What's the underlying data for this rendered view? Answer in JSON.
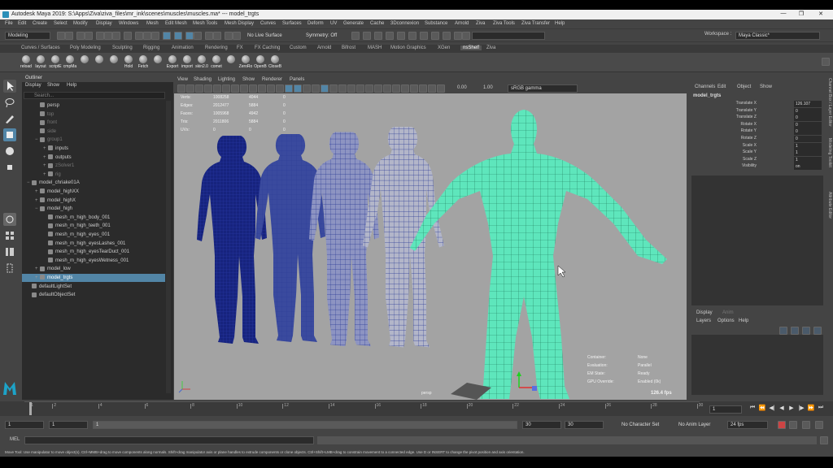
{
  "window": {
    "title": "Autodesk Maya 2019: S:\\Apps\\Ziva\\ziva_files\\mr_ink\\scenes\\muscles\\muscles.ma*  ---  model_trgts"
  },
  "menu": [
    "File",
    "Edit",
    "Create",
    "Select",
    "Modify",
    "Display",
    "Windows",
    "Mesh",
    "Edit Mesh",
    "Mesh Tools",
    "Mesh Display",
    "Curves",
    "Surfaces",
    "Deform",
    "UV",
    "Generate",
    "Cache",
    "3Dconnexion",
    "Substance",
    "Arnold",
    "Ziva",
    "Ziva Tools",
    "Ziva Transfer",
    "Help"
  ],
  "workspace": {
    "label": "Workspace :",
    "value": "Maya Classic*"
  },
  "status": {
    "mode": "Modeling",
    "live_surface": "No Live Surface",
    "symmetry": "Symmetry: Off"
  },
  "shelf_tabs": [
    "Curves / Surfaces",
    "Poly Modeling",
    "Sculpting",
    "Rigging",
    "Animation",
    "Rendering",
    "FX",
    "FX Caching",
    "Custom",
    "Arnold",
    "Bifrost",
    "MASH",
    "Motion Graphics",
    "XGen",
    "nsShelf",
    "Ziva"
  ],
  "shelf_active": "nsShelf",
  "shelf_buttons": [
    "reload",
    "layout",
    "scriptE",
    "cmpMa",
    "",
    "",
    "",
    "Hold",
    "Fetch",
    "",
    "Export",
    "import",
    "skin2.0",
    "comet",
    "",
    "ZeroRo",
    "OpenB",
    "CloseB"
  ],
  "outliner": {
    "title": "Outliner",
    "menu": [
      "Display",
      "Show",
      "Help"
    ],
    "search_placeholder": "Search...",
    "rows": [
      {
        "label": "persp",
        "indent": 1,
        "exp": "",
        "dim": false,
        "sel": false
      },
      {
        "label": "top",
        "indent": 1,
        "exp": "",
        "dim": true,
        "sel": false
      },
      {
        "label": "front",
        "indent": 1,
        "exp": "",
        "dim": true,
        "sel": false
      },
      {
        "label": "side",
        "indent": 1,
        "exp": "",
        "dim": true,
        "sel": false
      },
      {
        "label": "group1",
        "indent": 1,
        "exp": "−",
        "dim": true,
        "sel": false
      },
      {
        "label": "inputs",
        "indent": 2,
        "exp": "+",
        "dim": false,
        "sel": false
      },
      {
        "label": "outputs",
        "indent": 2,
        "exp": "+",
        "dim": false,
        "sel": false
      },
      {
        "label": "zSolver1",
        "indent": 2,
        "exp": "+",
        "dim": true,
        "sel": false
      },
      {
        "label": "rig",
        "indent": 2,
        "exp": "+",
        "dim": true,
        "sel": false
      },
      {
        "label": "model_chriake01A",
        "indent": 0,
        "exp": "−",
        "dim": false,
        "sel": false
      },
      {
        "label": "model_highXX",
        "indent": 1,
        "exp": "+",
        "dim": false,
        "sel": false
      },
      {
        "label": "model_highX",
        "indent": 1,
        "exp": "+",
        "dim": false,
        "sel": false
      },
      {
        "label": "model_high",
        "indent": 1,
        "exp": "−",
        "dim": false,
        "sel": false
      },
      {
        "label": "mesh_m_high_body_001",
        "indent": 2,
        "exp": "",
        "dim": false,
        "sel": false
      },
      {
        "label": "mesh_m_high_teeth_001",
        "indent": 2,
        "exp": "",
        "dim": false,
        "sel": false
      },
      {
        "label": "mesh_m_high_eyes_001",
        "indent": 2,
        "exp": "",
        "dim": false,
        "sel": false
      },
      {
        "label": "mesh_m_high_eyesLashes_001",
        "indent": 2,
        "exp": "",
        "dim": false,
        "sel": false
      },
      {
        "label": "mesh_m_high_eyesTearDuct_001",
        "indent": 2,
        "exp": "",
        "dim": false,
        "sel": false
      },
      {
        "label": "mesh_m_high_eyesWetness_001",
        "indent": 2,
        "exp": "",
        "dim": false,
        "sel": false
      },
      {
        "label": "model_low",
        "indent": 1,
        "exp": "+",
        "dim": false,
        "sel": false
      },
      {
        "label": "model_trgts",
        "indent": 1,
        "exp": "+",
        "dim": false,
        "sel": true
      },
      {
        "label": "defaultLightSet",
        "indent": 0,
        "exp": "",
        "dim": false,
        "sel": false
      },
      {
        "label": "defaultObjectSet",
        "indent": 0,
        "exp": "",
        "dim": false,
        "sel": false
      }
    ]
  },
  "viewport": {
    "menu": [
      "View",
      "Shading",
      "Lighting",
      "Show",
      "Renderer",
      "Panels"
    ],
    "exposure": "0.00",
    "gamma": "1.00",
    "colorspace": "sRGB gamma",
    "camera": "persp",
    "stats": [
      {
        "label": "Verts:",
        "a": "1008258",
        "b": "4044",
        "c": "0"
      },
      {
        "label": "Edges:",
        "a": "2012477",
        "b": "5884",
        "c": "0"
      },
      {
        "label": "Faces:",
        "a": "1005968",
        "b": "4942",
        "c": "0"
      },
      {
        "label": "Tris:",
        "a": "2011806",
        "b": "5884",
        "c": "0"
      },
      {
        "label": "UVs:",
        "a": "0",
        "b": "0",
        "c": "0"
      }
    ],
    "eval": [
      {
        "label": "Container:",
        "value": "None"
      },
      {
        "label": "Evaluation:",
        "value": "Parallel"
      },
      {
        "label": "EM State:",
        "value": "Ready"
      },
      {
        "label": "GPU Override:",
        "value": "Enabled (0k)"
      }
    ],
    "fps": "126.4 fps"
  },
  "channel_box": {
    "menu": [
      "Channels",
      "Edit",
      "Object",
      "Show"
    ],
    "object": "model_trgts",
    "attrs": [
      {
        "name": "Translate X",
        "value": "126.107"
      },
      {
        "name": "Translate Y",
        "value": "0"
      },
      {
        "name": "Translate Z",
        "value": "0"
      },
      {
        "name": "Rotate X",
        "value": "0"
      },
      {
        "name": "Rotate Y",
        "value": "0"
      },
      {
        "name": "Rotate Z",
        "value": "0"
      },
      {
        "name": "Scale X",
        "value": "1"
      },
      {
        "name": "Scale Y",
        "value": "1"
      },
      {
        "name": "Scale Z",
        "value": "1"
      },
      {
        "name": "Visibility",
        "value": "on"
      }
    ],
    "layer_tabs": [
      "Display",
      "Anim"
    ],
    "layer_menu": [
      "Layers",
      "Options",
      "Help"
    ],
    "side_tabs": [
      "Channel Box / Layer Editor",
      "Modeling Toolkit",
      "Attribute Editor"
    ]
  },
  "timeline": {
    "ticks": [
      "1",
      "2",
      "4",
      "6",
      "8",
      "10",
      "12",
      "14",
      "16",
      "18",
      "20",
      "22",
      "24",
      "26",
      "28",
      "30"
    ],
    "current": "1",
    "range_start": "1",
    "range_start2": "1",
    "range_inner": "1",
    "range_end": "30",
    "range_end2": "30",
    "character_set": "No Character Set",
    "anim_layer": "No Anim Layer",
    "fps": "24 fps"
  },
  "command": {
    "label": "MEL"
  },
  "help": "Move Tool: Use manipulator to move object(s). Ctrl+MMB+drag to move components along normals. Shift+drag manipulator axis or plane handles to extrude components or clone objects. Ctrl+Shift+LMB+drag to constrain movement to a connected edge. Use D or INSERT to change the pivot position and axis orientation.",
  "colors": {
    "selection": "#5285a6",
    "wire_blue": "#1c2d8c",
    "wire_green": "#4fe0b4",
    "viewport_bg": "#a3a3a3"
  }
}
